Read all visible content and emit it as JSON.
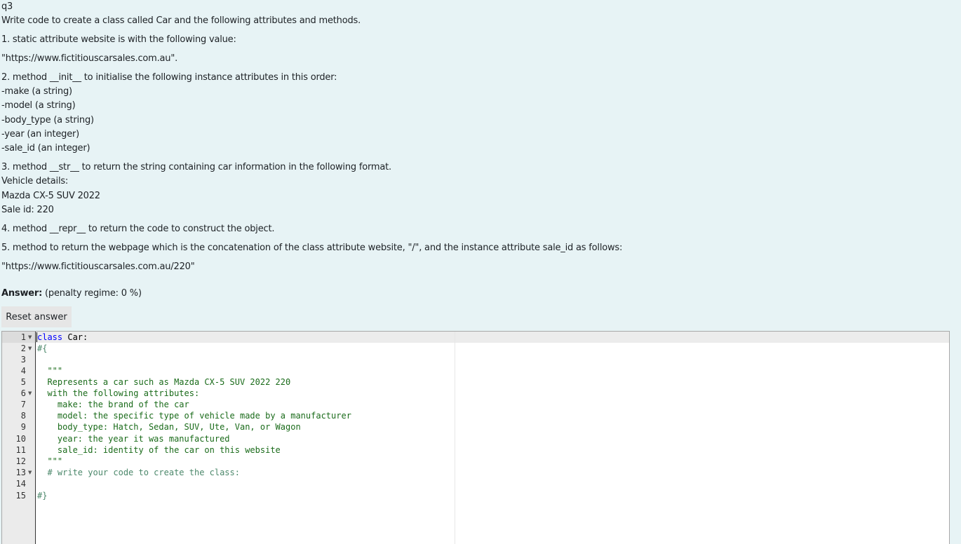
{
  "question": {
    "name": "q3",
    "lines": [
      "Write code to create a class called Car and the following attributes and methods.",
      "1. static attribute website is with the following value:",
      "\"https://www.fictitiouscarsales.com.au\".",
      "2. method __init__ to initialise the following instance attributes in this order:",
      "-make (a string)",
      "-model (a string)",
      "-body_type (a string)",
      "-year (an integer)",
      "-sale_id (an integer)",
      "3. method __str__ to return the string containing car information in the following format.",
      "Vehicle details:",
      "Mazda CX-5 SUV 2022",
      "Sale id: 220",
      "4. method __repr__ to return the code to construct the object.",
      "5. method  to return the webpage which is the concatenation of the class attribute website, \"/\", and the instance attribute sale_id as follows:",
      "\"https://www.fictitiouscarsales.com.au/220\""
    ]
  },
  "answer": {
    "label": "Answer:",
    "penalty": "(penalty regime: 0 %)"
  },
  "reset_button": {
    "label": "Reset answer"
  },
  "editor": {
    "line_numbers": [
      "1",
      "2",
      "3",
      "4",
      "5",
      "6",
      "7",
      "8",
      "9",
      "10",
      "11",
      "12",
      "13",
      "14",
      "15"
    ],
    "lines": {
      "l1_kw": "class",
      "l1_rest": " Car:",
      "l2": "#{",
      "l4": "  \"\"\"",
      "l5": "  Represents a car such as Mazda CX-5 SUV 2022 220",
      "l6": "  with the following attributes:",
      "l7": "    make: the brand of the car",
      "l8": "    model: the specific type of vehicle made by a manufacturer",
      "l9": "    body_type: Hatch, Sedan, SUV, Ute, Van, or Wagon",
      "l10": "    year: the year it was manufactured",
      "l11": "    sale_id: identity of the car on this website",
      "l12": "  \"\"\"",
      "l13": "  # write your code to create the class:",
      "l15": "#}"
    }
  }
}
